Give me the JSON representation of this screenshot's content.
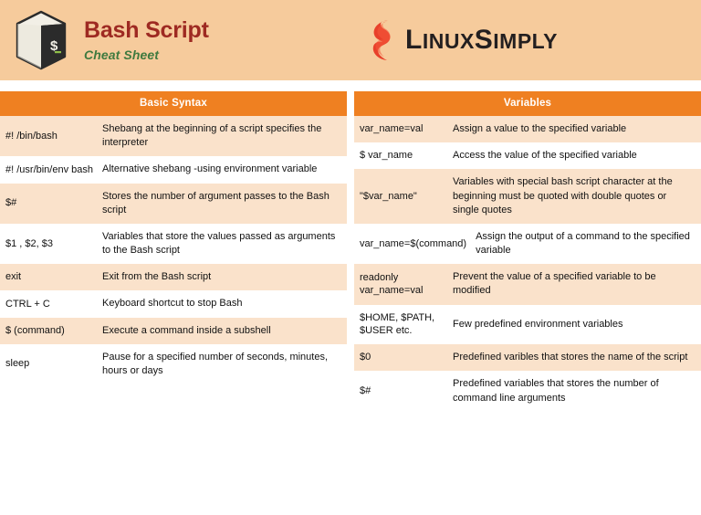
{
  "header": {
    "title": "Bash Script",
    "subtitle": "Cheat Sheet",
    "bash_icon": "bash-cube-icon",
    "bash_prompt_glyph": "$_",
    "brand": {
      "flame_icon": "linuxsimply-flame-icon",
      "word_linux_cap": "L",
      "word_linux_rest": "INUX",
      "word_simply_cap": "S",
      "word_simply_rest": "IMPLY",
      "full": "LinuxSimply"
    },
    "colors": {
      "header_bg": "#f6cb9c",
      "title": "#9e2a22",
      "subtitle": "#3f7a3f",
      "accent_orange": "#ef8021",
      "row_tint": "#fae2cb",
      "flame": "#e8402a"
    }
  },
  "columns": [
    {
      "id": "basic-syntax",
      "header": "Basic Syntax",
      "rows": [
        {
          "key": "#! /bin/bash",
          "desc": "Shebang at the beginning of a script specifies the interpreter"
        },
        {
          "key": "#! /usr/bin/env bash",
          "desc": "Alternative shebang -using environment variable"
        },
        {
          "key": "$#",
          "desc": "Stores the number of argument passes to the Bash script"
        },
        {
          "key": "$1 , $2, $3",
          "desc": "Variables that store the values passed as arguments to the Bash script"
        },
        {
          "key": "exit",
          "desc": "Exit from the Bash script"
        },
        {
          "key": "CTRL + C",
          "desc": "Keyboard shortcut to stop Bash"
        },
        {
          "key": "$ (command)",
          "desc": "Execute a command inside a subshell"
        },
        {
          "key": "sleep",
          "desc": "Pause for a specified number of seconds, minutes, hours or days"
        }
      ]
    },
    {
      "id": "variables",
      "header": "Variables",
      "rows": [
        {
          "key": "var_name=val",
          "desc": "Assign a value to the specified variable"
        },
        {
          "key": "$ var_name",
          "desc": "Access the value of the specified variable"
        },
        {
          "key": "\"$var_name\"",
          "desc": "Variables with special bash script character at the beginning must be quoted with double quotes or single quotes"
        },
        {
          "key": "var_name=$(command)",
          "desc": "Assign the output of a command to the specified variable"
        },
        {
          "key": "readonly var_name=val",
          "desc": "Prevent the value of a specified variable to be modified"
        },
        {
          "key": "$HOME, $PATH, $USER etc.",
          "desc": "Few predefined environment variables"
        },
        {
          "key": "$0",
          "desc": "Predefined varibles that stores the name of the script"
        },
        {
          "key": "$#",
          "desc": "Predefined variables that stores the number of command line arguments"
        }
      ]
    }
  ]
}
